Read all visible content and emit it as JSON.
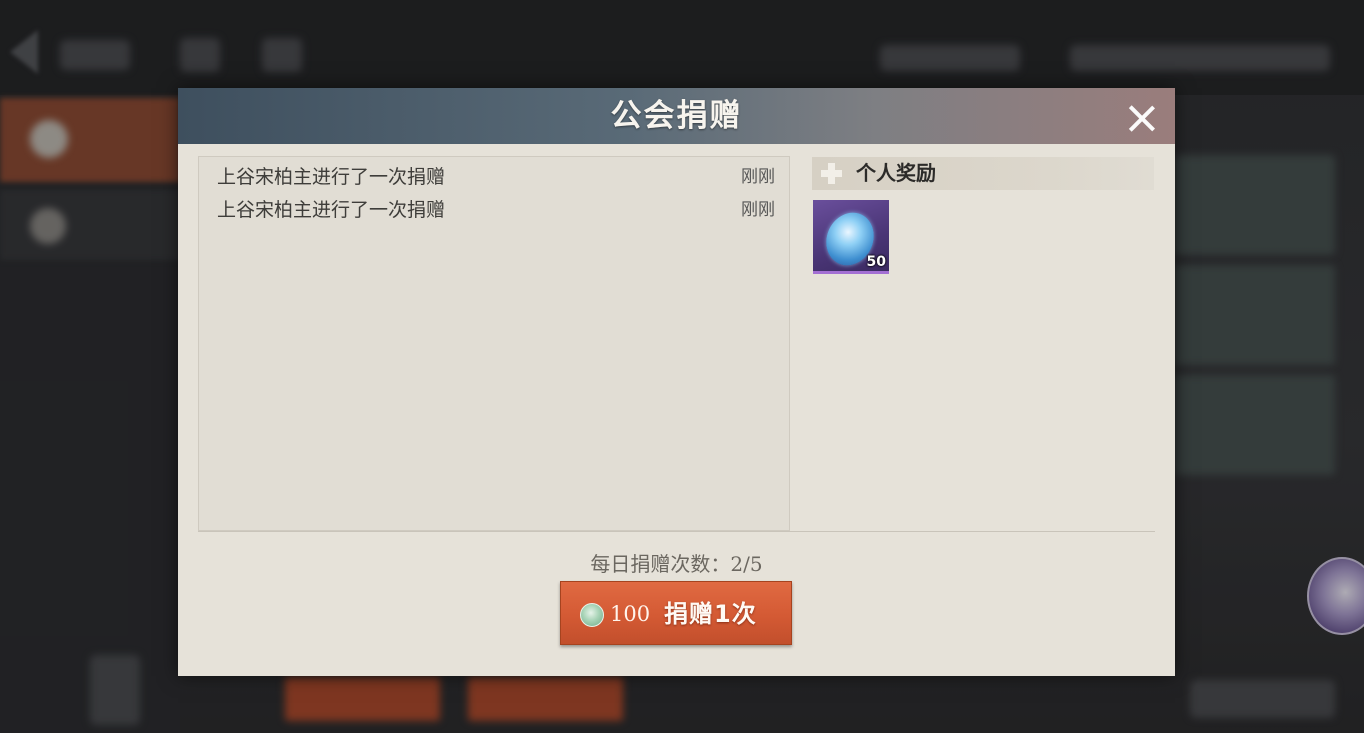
{
  "dialog": {
    "title": "公会捐赠",
    "close_icon": "close-icon"
  },
  "log": {
    "entries": [
      {
        "text": "上谷宋柏主进行了一次捐赠",
        "time": "刚刚"
      },
      {
        "text": "上谷宋柏主进行了一次捐赠",
        "time": "刚刚"
      }
    ]
  },
  "rewards": {
    "title": "个人奖励",
    "header_icon": "plus-icon",
    "items": [
      {
        "icon": "blue-gem-icon",
        "quantity": "50"
      }
    ]
  },
  "daily": {
    "label": "每日捐赠次数：2/5"
  },
  "donate_button": {
    "currency_icon": "coin-icon",
    "cost": "100",
    "label": "捐赠1次"
  },
  "colors": {
    "header_gradient_start": "#3e4f5e",
    "header_gradient_end": "#9a7d7c",
    "dialog_bg": "#e6e2d9",
    "button_bg": "#d45a34",
    "reward_item_bg": "#4a3576"
  }
}
